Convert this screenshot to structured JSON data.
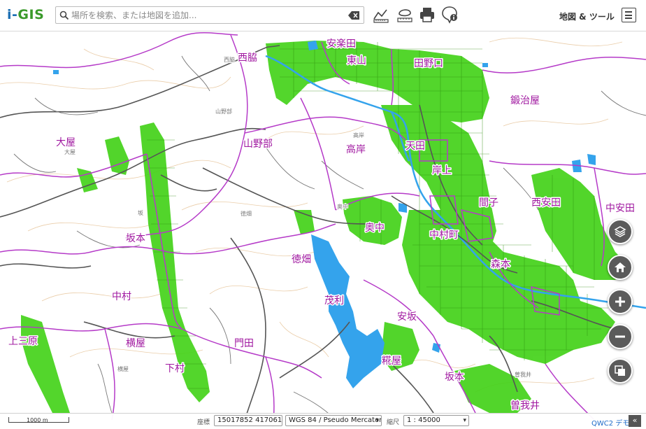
{
  "app": {
    "logo_i": "i-",
    "logo_rest": "GIS"
  },
  "search": {
    "placeholder": "場所を検索、または地図を追加..."
  },
  "toolbar": {
    "tools": [
      "measure-icon",
      "draw-icon",
      "print-icon",
      "info-icon"
    ],
    "map_tools_label": "地図 & ツール"
  },
  "map": {
    "place_labels": {
      "kiraku": "安楽田",
      "nishiwaki": "西脇",
      "higashiyama": "東山",
      "tanoguchi": "田野口",
      "kajiya": "鍛治屋",
      "oya": "大屋",
      "yamanobe": "山野部",
      "takagishi": "高岸",
      "tenda": "天田",
      "kishiue": "岸上",
      "nishiyasuda": "西安田",
      "nakayasuda": "中安田",
      "koma": "間子",
      "okunaka": "奥中",
      "sakamoto_w": "坂本",
      "nakamuracho": "中村町",
      "tokuhata": "徳畑",
      "morimoto": "森本",
      "nakamura": "中村",
      "shigeri": "茂利",
      "yasaka": "安坂",
      "kamisanbara": "上三原",
      "yokoya": "横屋",
      "monden": "門田",
      "shimomura": "下村",
      "koya": "糀屋",
      "sakamoto_s": "坂本",
      "sogai": "曽我井"
    },
    "small_labels": {
      "nishiwaki": "西脇",
      "yamanobe": "山野部",
      "oya": "大屋",
      "saka": "坂",
      "tokuhata": "徳畑",
      "takagishi": "高岸",
      "okunaka": "奥中",
      "yokoya": "横屋",
      "sogai": "曽我井"
    },
    "colors": {
      "urban": "#44d21a",
      "boundary": "#b53ac8",
      "water": "#34a3ec",
      "road": "#555555",
      "contour": "#e8c8a0"
    }
  },
  "controls": [
    "layers-icon",
    "home-icon",
    "zoom-in-icon",
    "zoom-out-icon",
    "basemap-icon"
  ],
  "footer": {
    "scale_text": "1000 m",
    "coord_label": "座標",
    "coords": "15017852 4170614",
    "crs": "WGS 84 / Pseudo Mercator",
    "scale_label": "縮尺",
    "scale_value": "1 : 45000",
    "demo_link": "QWC2 デモ",
    "collapse_glyph": "«"
  }
}
